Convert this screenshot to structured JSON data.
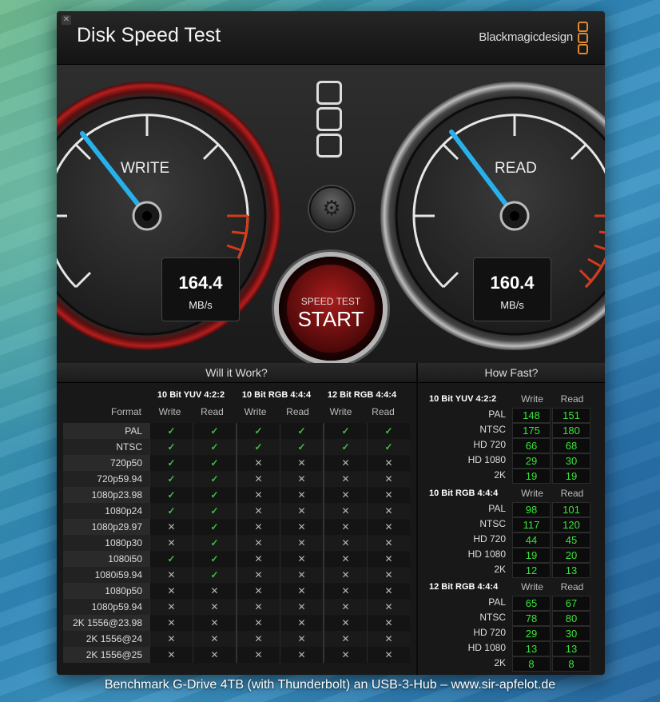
{
  "window": {
    "title": "Disk Speed Test",
    "brand": "Blackmagicdesign"
  },
  "gauges": {
    "write": {
      "label": "WRITE",
      "value": "164.4",
      "unit": "MB/s"
    },
    "read": {
      "label": "READ",
      "value": "160.4",
      "unit": "MB/s"
    }
  },
  "start_button": {
    "top": "SPEED TEST",
    "main": "START"
  },
  "will_it_work": {
    "title": "Will it Work?",
    "groups": [
      "10 Bit YUV 4:2:2",
      "10 Bit RGB 4:4:4",
      "12 Bit RGB 4:4:4"
    ],
    "format_header": "Format",
    "write_label": "Write",
    "read_label": "Read",
    "rows": [
      {
        "format": "PAL",
        "cells": [
          1,
          1,
          1,
          1,
          1,
          1
        ]
      },
      {
        "format": "NTSC",
        "cells": [
          1,
          1,
          1,
          1,
          1,
          1
        ]
      },
      {
        "format": "720p50",
        "cells": [
          1,
          1,
          0,
          0,
          0,
          0
        ]
      },
      {
        "format": "720p59.94",
        "cells": [
          1,
          1,
          0,
          0,
          0,
          0
        ]
      },
      {
        "format": "1080p23.98",
        "cells": [
          1,
          1,
          0,
          0,
          0,
          0
        ]
      },
      {
        "format": "1080p24",
        "cells": [
          1,
          1,
          0,
          0,
          0,
          0
        ]
      },
      {
        "format": "1080p29.97",
        "cells": [
          0,
          1,
          0,
          0,
          0,
          0
        ]
      },
      {
        "format": "1080p30",
        "cells": [
          0,
          1,
          0,
          0,
          0,
          0
        ]
      },
      {
        "format": "1080i50",
        "cells": [
          1,
          1,
          0,
          0,
          0,
          0
        ]
      },
      {
        "format": "1080i59.94",
        "cells": [
          0,
          1,
          0,
          0,
          0,
          0
        ]
      },
      {
        "format": "1080p50",
        "cells": [
          0,
          0,
          0,
          0,
          0,
          0
        ]
      },
      {
        "format": "1080p59.94",
        "cells": [
          0,
          0,
          0,
          0,
          0,
          0
        ]
      },
      {
        "format": "2K 1556@23.98",
        "cells": [
          0,
          0,
          0,
          0,
          0,
          0
        ]
      },
      {
        "format": "2K 1556@24",
        "cells": [
          0,
          0,
          0,
          0,
          0,
          0
        ]
      },
      {
        "format": "2K 1556@25",
        "cells": [
          0,
          0,
          0,
          0,
          0,
          0
        ]
      }
    ]
  },
  "how_fast": {
    "title": "How Fast?",
    "write_label": "Write",
    "read_label": "Read",
    "blocks": [
      {
        "title": "10 Bit YUV 4:2:2",
        "rows": [
          {
            "label": "PAL",
            "write": "148",
            "read": "151"
          },
          {
            "label": "NTSC",
            "write": "175",
            "read": "180"
          },
          {
            "label": "HD 720",
            "write": "66",
            "read": "68"
          },
          {
            "label": "HD 1080",
            "write": "29",
            "read": "30"
          },
          {
            "label": "2K",
            "write": "19",
            "read": "19"
          }
        ]
      },
      {
        "title": "10 Bit RGB 4:4:4",
        "rows": [
          {
            "label": "PAL",
            "write": "98",
            "read": "101"
          },
          {
            "label": "NTSC",
            "write": "117",
            "read": "120"
          },
          {
            "label": "HD 720",
            "write": "44",
            "read": "45"
          },
          {
            "label": "HD 1080",
            "write": "19",
            "read": "20"
          },
          {
            "label": "2K",
            "write": "12",
            "read": "13"
          }
        ]
      },
      {
        "title": "12 Bit RGB 4:4:4",
        "rows": [
          {
            "label": "PAL",
            "write": "65",
            "read": "67"
          },
          {
            "label": "NTSC",
            "write": "78",
            "read": "80"
          },
          {
            "label": "HD 720",
            "write": "29",
            "read": "30"
          },
          {
            "label": "HD 1080",
            "write": "13",
            "read": "13"
          },
          {
            "label": "2K",
            "write": "8",
            "read": "8"
          }
        ]
      }
    ]
  },
  "caption": "Benchmark G-Drive 4TB (with Thunderbolt) an USB-3-Hub – www.sir-apfelot.de",
  "icons": {
    "close": "close-icon",
    "gear": "gear-icon",
    "check": "check-icon",
    "cross": "cross-icon"
  }
}
